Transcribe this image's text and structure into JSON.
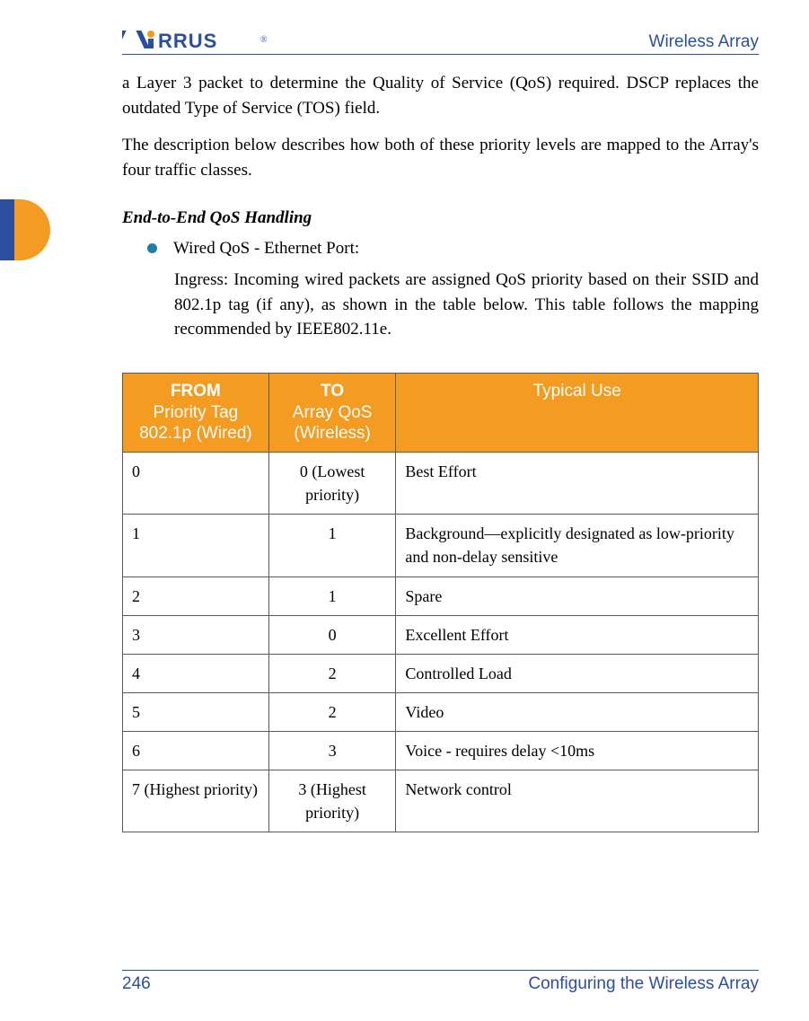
{
  "header": {
    "brand": "XIRRUS",
    "brand_reg": "®",
    "product": "Wireless Array"
  },
  "body": {
    "para1": "a Layer 3 packet to determine the Quality of Service (QoS) required. DSCP replaces the outdated Type of Service (TOS) field.",
    "para2": "The description below describes how both of these priority levels are mapped to the Array's four traffic classes.",
    "heading": "End-to-End QoS Handling",
    "bullet1": "Wired QoS - Ethernet Port:",
    "bullet1_sub": "Ingress: Incoming wired packets are assigned QoS priority based on their SSID and 802.1p tag (if any), as shown in the table below. This table follows the mapping recommended by IEEE802.11e."
  },
  "table": {
    "headers": {
      "from_label": "FROM",
      "from_sub": "Priority Tag 802.1p (Wired)",
      "to_label": "TO",
      "to_sub": "Array QoS (Wireless)",
      "use": "Typical Use"
    },
    "rows": [
      {
        "from": "0",
        "to": "0 (Lowest priority)",
        "use": "Best Effort"
      },
      {
        "from": "1",
        "to": "1",
        "use": "Background—explicitly designated as low-priority and non-delay sensitive"
      },
      {
        "from": "2",
        "to": "1",
        "use": "Spare"
      },
      {
        "from": "3",
        "to": "0",
        "use": "Excellent Effort"
      },
      {
        "from": "4",
        "to": "2",
        "use": "Controlled Load"
      },
      {
        "from": "5",
        "to": "2",
        "use": "Video"
      },
      {
        "from": "6",
        "to": "3",
        "use": "Voice - requires delay <10ms"
      },
      {
        "from": "7 (Highest priority)",
        "to": "3 (Highest priority)",
        "use": "Network control"
      }
    ]
  },
  "footer": {
    "page": "246",
    "section": "Configuring the Wireless Array"
  }
}
